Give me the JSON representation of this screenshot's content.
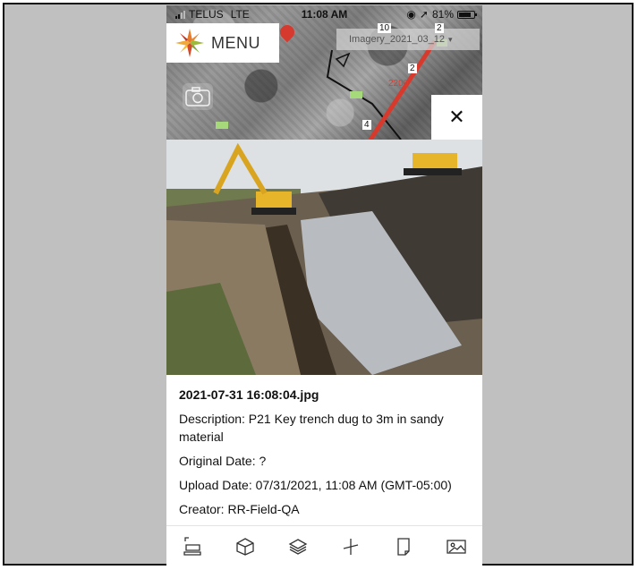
{
  "status_bar": {
    "carrier": "TELUS",
    "network": "LTE",
    "time": "11:08 AM",
    "battery": "81%",
    "battery_level": 0.81
  },
  "header": {
    "menu_label": "MENU"
  },
  "map": {
    "imagery_layer": "Imagery_2021_03_12",
    "distance_label": "2200",
    "cluster_counts": [
      "10",
      "2",
      "2",
      "4"
    ]
  },
  "photo_detail": {
    "file_name": "2021-07-31 16:08:04.jpg",
    "description": "Description: P21 Key trench dug to 3m in sandy material",
    "original_date": "Original Date: ?",
    "upload_date": "Upload Date: 07/31/2021, 11:08 AM (GMT-05:00)",
    "creator": "Creator: RR-Field-QA"
  },
  "toolbar": {
    "items": [
      "measure-tool-icon",
      "3d-box-icon",
      "layers-icon",
      "coordinate-icon",
      "document-icon",
      "image-icon"
    ]
  },
  "colors": {
    "accent_red": "#e23b2e",
    "frame_background": "#c0c0c0"
  }
}
